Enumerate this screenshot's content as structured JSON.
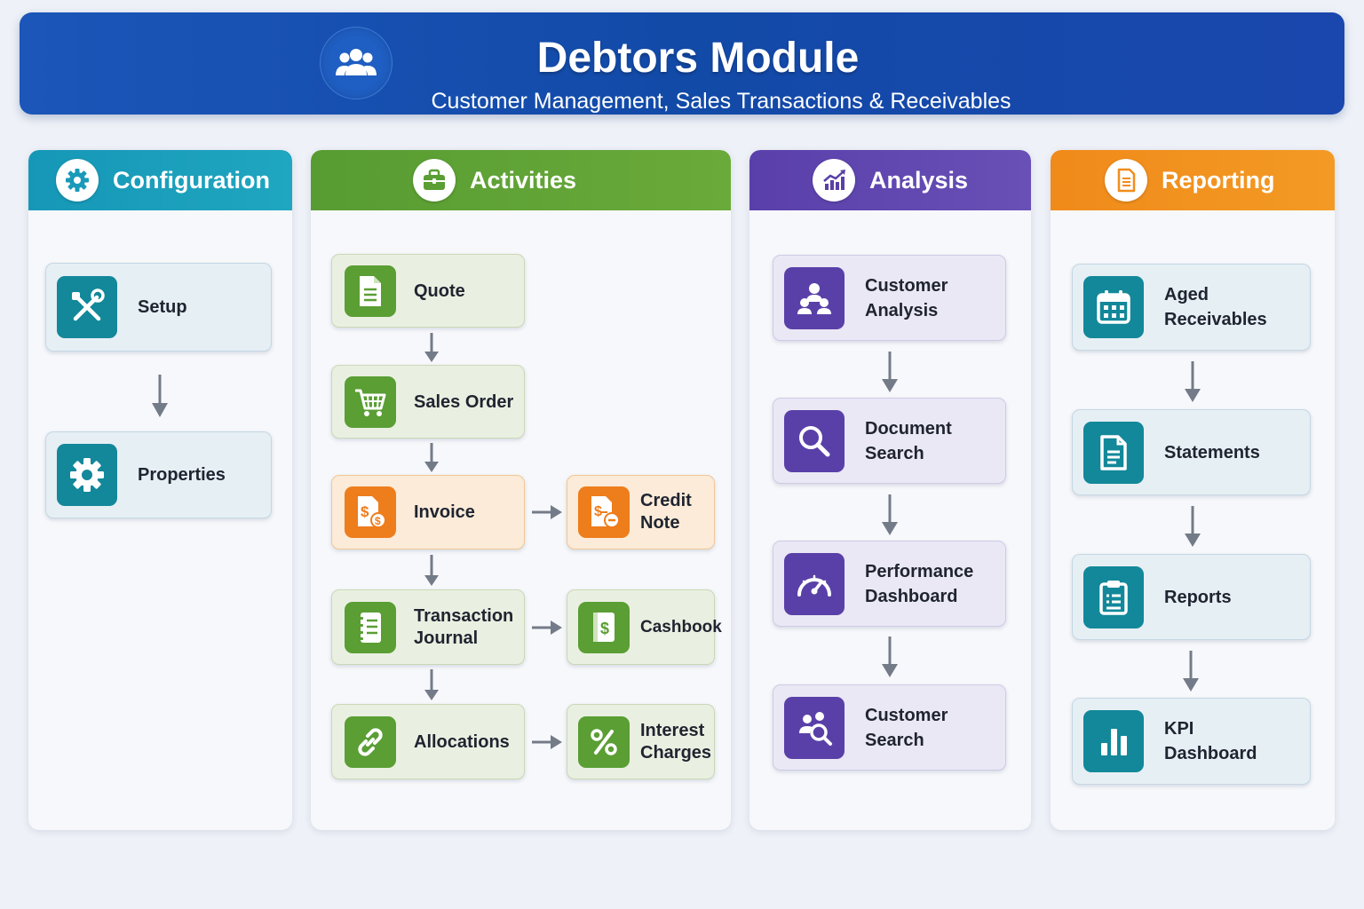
{
  "header": {
    "title": "Debtors Module",
    "subtitle": "Customer Management, Sales Transactions & Receivables",
    "icon": "users-icon"
  },
  "colors": {
    "header_blue": "#124aa8",
    "configuration": "#1a9ab8",
    "activities": "#5a9e34",
    "analysis": "#5940a8",
    "reporting": "#f08d1c",
    "arrow": "#747b88"
  },
  "columns": {
    "configuration": {
      "title": "Configuration",
      "icon": "gear-icon",
      "items": [
        {
          "label": "Setup",
          "icon": "tools-icon"
        },
        {
          "label": "Properties",
          "icon": "gear-icon"
        }
      ]
    },
    "activities": {
      "title": "Activities",
      "icon": "briefcase-icon",
      "items": [
        {
          "label": "Quote",
          "icon": "document-icon"
        },
        {
          "label": "Sales Order",
          "icon": "cart-icon"
        },
        {
          "label": "Invoice",
          "icon": "invoice-icon"
        },
        {
          "label": "Credit\nNote",
          "icon": "credit-note-icon"
        },
        {
          "label": "Transaction\nJournal",
          "icon": "journal-icon"
        },
        {
          "label": "Cashbook",
          "icon": "cashbook-icon"
        },
        {
          "label": "Allocations",
          "icon": "link-icon"
        },
        {
          "label": "Interest\nCharges",
          "icon": "percent-icon"
        }
      ]
    },
    "analysis": {
      "title": "Analysis",
      "icon": "chart-icon",
      "items": [
        {
          "label": "Customer\nAnalysis",
          "icon": "customers-icon"
        },
        {
          "label": "Document\nSearch",
          "icon": "search-icon"
        },
        {
          "label": "Performance\nDashboard",
          "icon": "gauge-icon"
        },
        {
          "label": "Customer\nSearch",
          "icon": "user-search-icon"
        }
      ]
    },
    "reporting": {
      "title": "Reporting",
      "icon": "report-icon",
      "items": [
        {
          "label": "Aged\nReceivables",
          "icon": "calendar-icon"
        },
        {
          "label": "Statements",
          "icon": "statement-icon"
        },
        {
          "label": "Reports",
          "icon": "clipboard-icon"
        },
        {
          "label": "KPI\nDashboard",
          "icon": "bar-chart-icon"
        }
      ]
    }
  }
}
